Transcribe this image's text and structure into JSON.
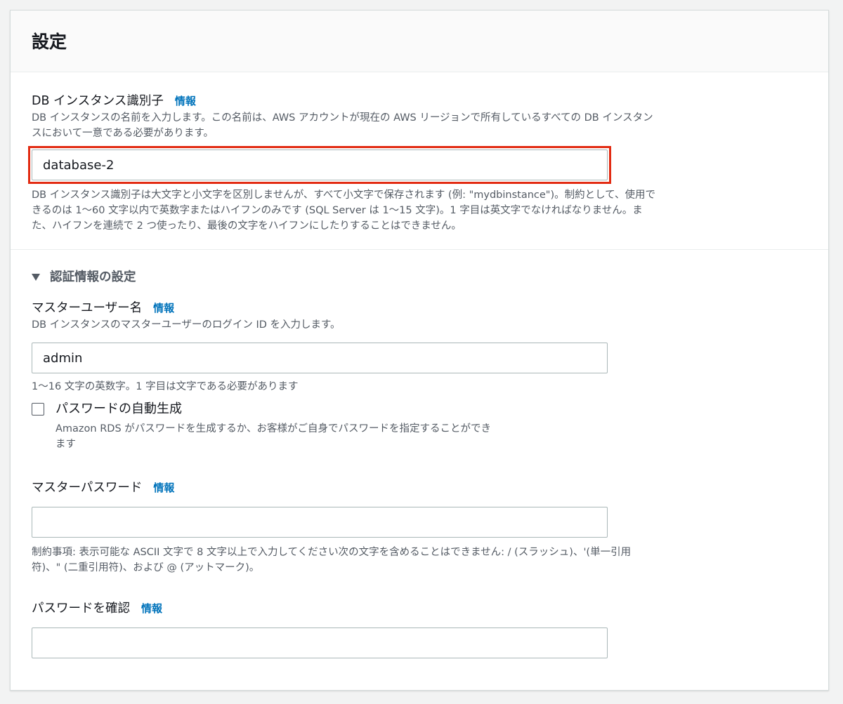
{
  "header": {
    "title": "設定"
  },
  "db_identifier": {
    "label": "DB インスタンス識別子",
    "info": "情報",
    "description_line1": "DB インスタンスの名前を入力します。この名前は、AWS アカウントが現在の AWS リージョンで所有しているすべての DB インスタン",
    "description_line2": "スにおいて一意である必要があります。",
    "value": "database-2",
    "constraint_line1": "DB インスタンス識別子は大文字と小文字を区別しませんが、すべて小文字で保存されます (例: \"mydbinstance\")。制約として、使用で",
    "constraint_line2": "きるのは 1〜60 文字以内で英数字またはハイフンのみです (SQL Server は 1〜15 文字)。1 字目は英文字でなければなりません。ま",
    "constraint_line3": "た、ハイフンを連続で 2 つ使ったり、最後の文字をハイフンにしたりすることはできません。"
  },
  "credentials": {
    "section_label": "認証情報の設定",
    "expanded": true,
    "master_username": {
      "label": "マスターユーザー名",
      "info": "情報",
      "description": "DB インスタンスのマスターユーザーのログイン ID を入力します。",
      "value": "admin",
      "constraint": "1〜16 文字の英数字。1 字目は文字である必要があります"
    },
    "auto_generate": {
      "label": "パスワードの自動生成",
      "checked": false,
      "description_line1": "Amazon RDS がパスワードを生成するか、お客様がご自身でパスワードを指定することができ",
      "description_line2": "ます"
    },
    "master_password": {
      "label": "マスターパスワード",
      "info": "情報",
      "value": "",
      "constraint_line1": "制約事項: 表示可能な ASCII 文字で 8 文字以上で入力してください次の文字を含めることはできません: / (スラッシュ)、'(単一引用",
      "constraint_line2": "符)、\" (二重引用符)、および @ (アットマーク)。"
    },
    "confirm_password": {
      "label": "パスワードを確認",
      "info": "情報",
      "value": ""
    }
  },
  "colors": {
    "link": "#0073bb",
    "highlight": "#e22b12",
    "secondary_text": "#545b64",
    "input_border": "#aab7b8"
  },
  "icons": {
    "expander": "caret-down-icon"
  }
}
